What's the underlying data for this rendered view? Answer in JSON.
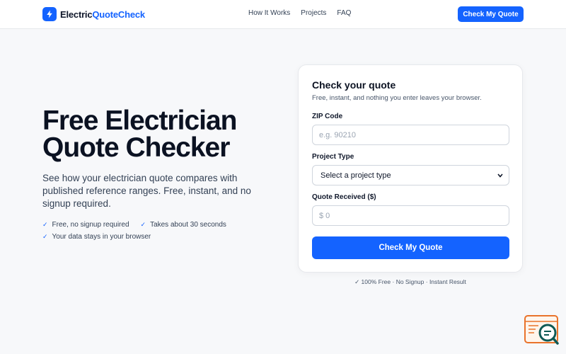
{
  "brand": {
    "name_part1": "Electric",
    "name_part2": "QuoteCheck",
    "icon": "lightning-bolt-icon",
    "color": "#1463ff"
  },
  "nav": {
    "items": [
      "How It Works",
      "Projects",
      "FAQ"
    ]
  },
  "header": {
    "cta_label": "Check My Quote"
  },
  "hero": {
    "title": "Free Electrician Quote Checker",
    "subtitle": "See how your electrician quote compares with published reference ranges. Free, instant, and no signup required.",
    "checks": [
      "Free, no signup required",
      "Takes about 30 seconds",
      "Your data stays in your browser"
    ]
  },
  "form": {
    "title": "Check your quote",
    "subtitle": "Free, instant, and nothing you enter leaves your browser.",
    "zip": {
      "label": "ZIP Code",
      "placeholder": "e.g. 90210",
      "value": ""
    },
    "project": {
      "label": "Project Type",
      "selected": "Select a project type"
    },
    "quote": {
      "label": "Quote Received ($)",
      "placeholder": "$ 0",
      "value": ""
    },
    "submit_label": "Check My Quote"
  },
  "trust_line": "✓ 100% Free · No Signup · Instant Result",
  "widget": {
    "icon": "chat-search-icon"
  },
  "colors": {
    "accent": "#1463ff",
    "text": "#0b1222",
    "muted": "#475569",
    "widget_orange": "#e9732b",
    "widget_teal": "#0f5a55"
  }
}
